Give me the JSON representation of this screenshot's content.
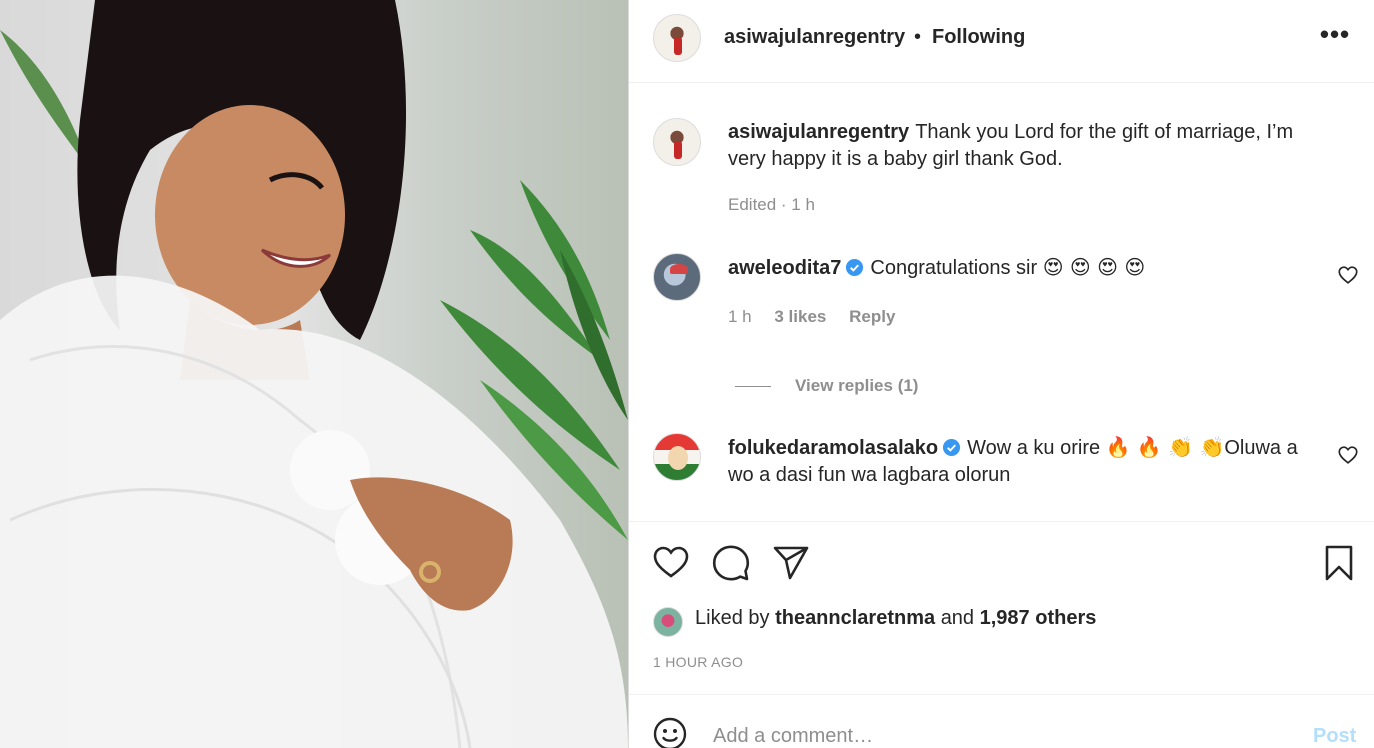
{
  "post": {
    "owner_username": "asiwajulanregentry",
    "follow_separator": "•",
    "follow_status": "Following",
    "more_label": "•••",
    "caption": "Thank you Lord for the gift of marriage, I’m very happy it is a baby girl thank God.",
    "caption_meta": "Edited · 1 h"
  },
  "comments": [
    {
      "username": "aweleodita7",
      "verified": true,
      "text": "Congratulations sir",
      "emojis": "😍 😍 😍 😍",
      "time": "1 h",
      "likes": "3 likes",
      "reply_label": "Reply",
      "view_replies": "View replies (1)"
    },
    {
      "username": "folukedaramolasalako",
      "verified": true,
      "text_before": "Wow a ku orire",
      "emojis": "🔥 🔥 👏 👏",
      "text_after": "Oluwa a wo a dasi fun wa lagbara olorun"
    }
  ],
  "likes": {
    "prefix": "Liked by",
    "user": "theannclaretnma",
    "conjunction": "and",
    "others": "1,987 others"
  },
  "timestamp": "1 HOUR AGO",
  "add_comment": {
    "placeholder": "Add a comment…",
    "post_label": "Post"
  },
  "icons": {
    "like": "heart-icon",
    "comment": "comment-bubble-icon",
    "share": "paper-plane-icon",
    "save": "bookmark-icon",
    "emoji": "smiley-icon",
    "verified": "verified-badge-icon"
  },
  "colors": {
    "verified": "#3897f0",
    "post_disabled": "#b2dffc",
    "secondary_text": "#8e8e8e"
  }
}
